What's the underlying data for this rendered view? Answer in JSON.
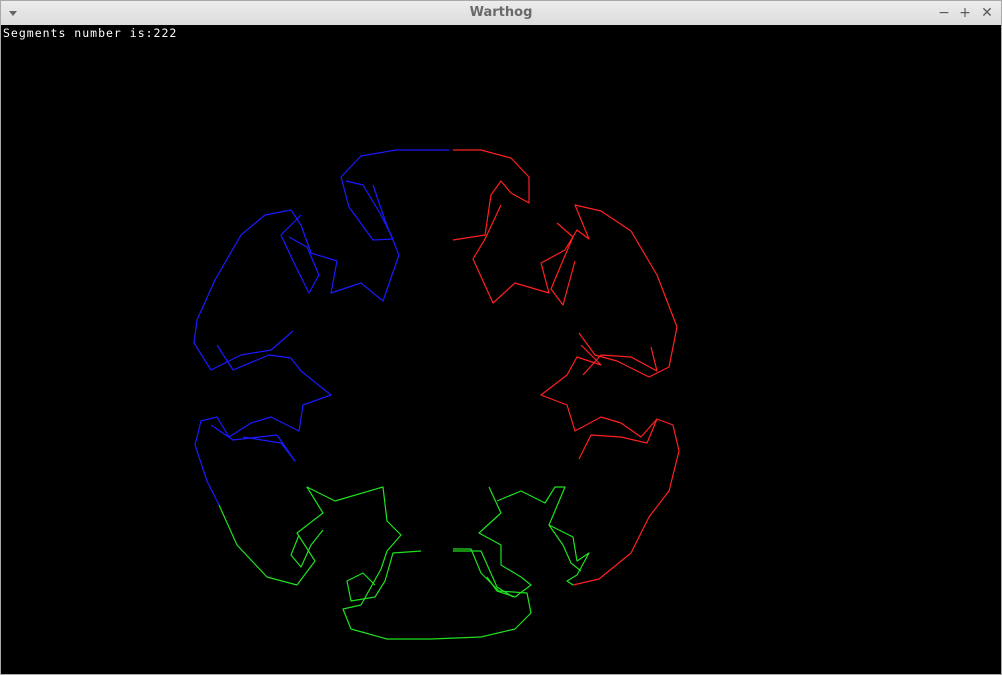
{
  "window": {
    "title": "Warthog",
    "controls": {
      "minimize": "−",
      "maximize": "+",
      "close": "✕"
    }
  },
  "status": {
    "text": "Segments number is:222"
  },
  "drawing": {
    "segments_count": 222,
    "colors": {
      "upper_left": "#1a1aff",
      "upper_right": "#ff2020",
      "bottom": "#20e020",
      "background": "#000000"
    },
    "symmetry": "six-fold snowflake fractal outline"
  }
}
